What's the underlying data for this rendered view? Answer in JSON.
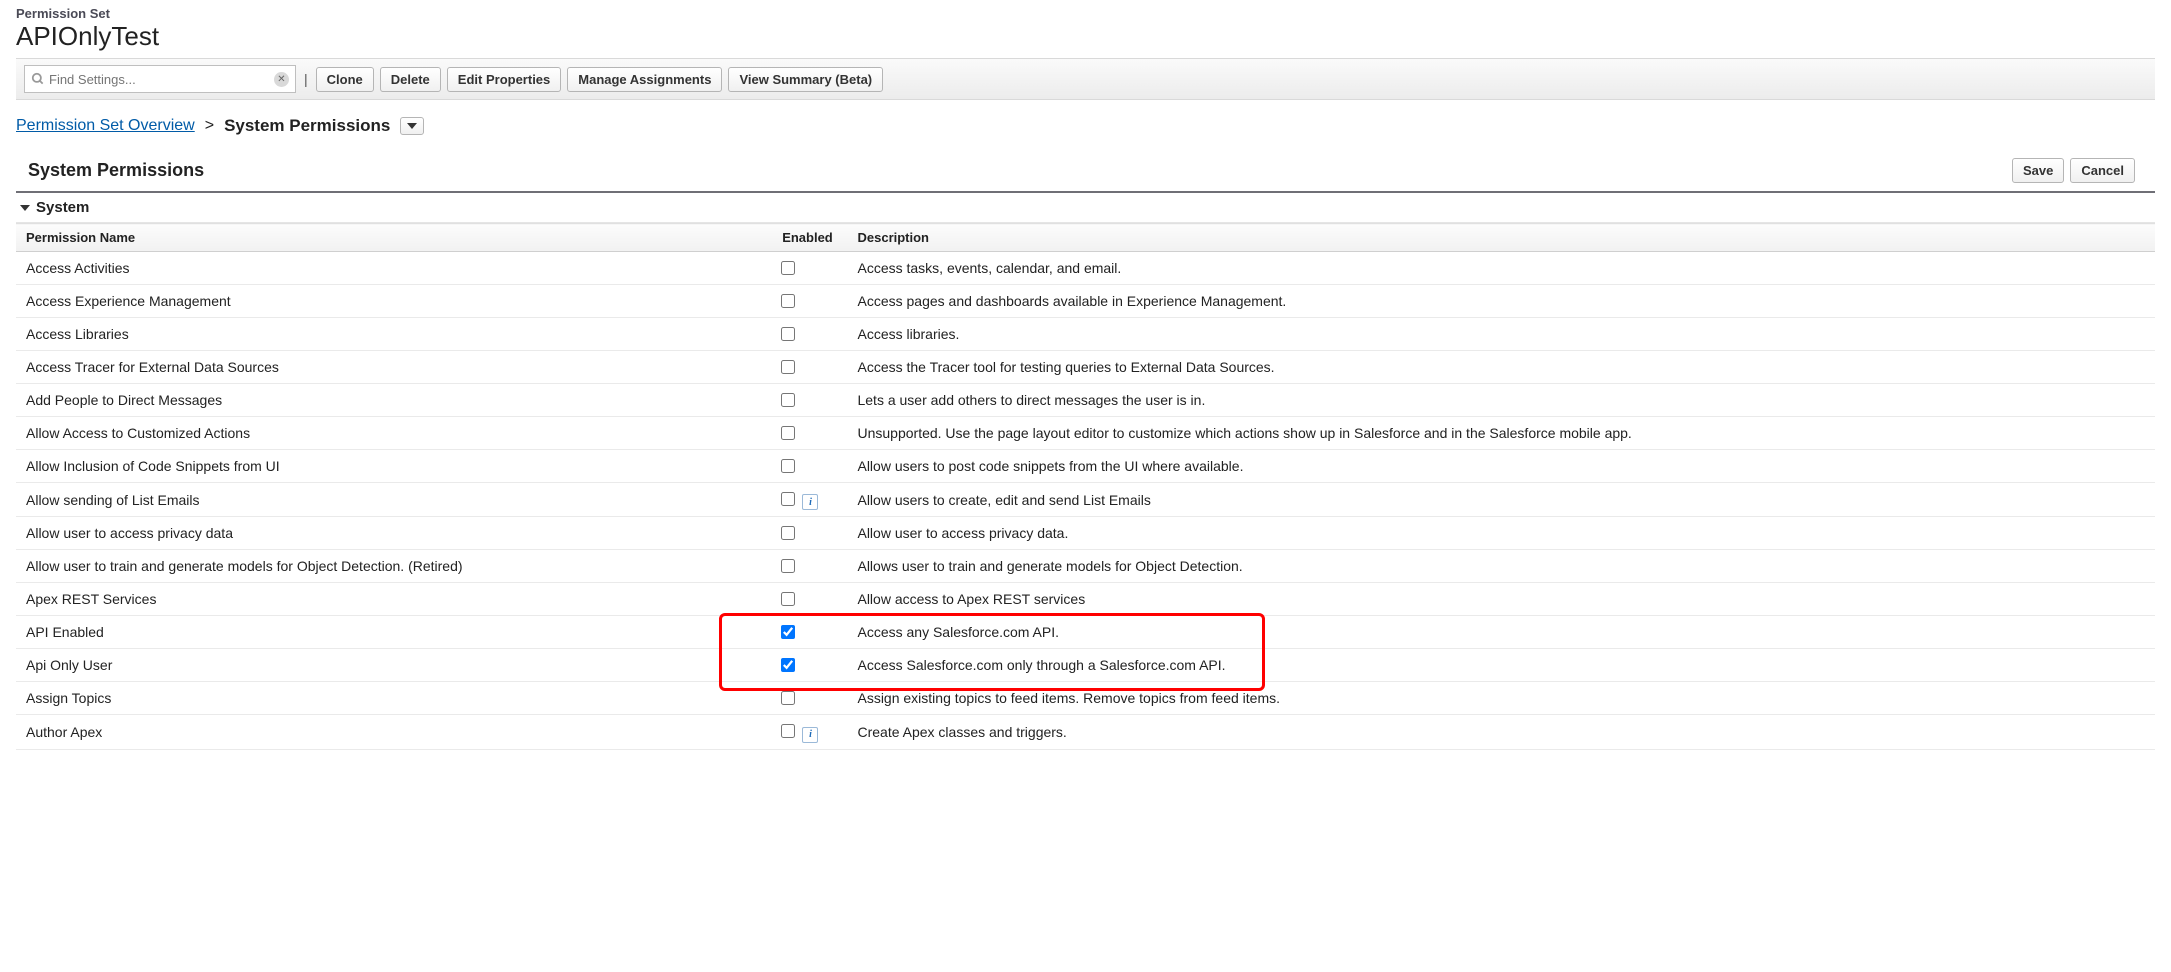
{
  "header": {
    "object_label": "Permission Set",
    "title": "APIOnlyTest",
    "search_placeholder": "Find Settings...",
    "buttons": {
      "clone": "Clone",
      "delete": "Delete",
      "edit": "Edit Properties",
      "manage": "Manage Assignments",
      "summary": "View Summary (Beta)"
    }
  },
  "breadcrumb": {
    "overview": "Permission Set Overview",
    "current": "System Permissions"
  },
  "section": {
    "title": "System Permissions",
    "save": "Save",
    "cancel": "Cancel",
    "group": "System"
  },
  "columns": {
    "name": "Permission Name",
    "enabled": "Enabled",
    "description": "Description"
  },
  "permissions": [
    {
      "name": "Access Activities",
      "enabled": false,
      "info": false,
      "desc": "Access tasks, events, calendar, and email."
    },
    {
      "name": "Access Experience Management",
      "enabled": false,
      "info": false,
      "desc": "Access pages and dashboards available in Experience Management."
    },
    {
      "name": "Access Libraries",
      "enabled": false,
      "info": false,
      "desc": "Access libraries."
    },
    {
      "name": "Access Tracer for External Data Sources",
      "enabled": false,
      "info": false,
      "desc": "Access the Tracer tool for testing queries to External Data Sources."
    },
    {
      "name": "Add People to Direct Messages",
      "enabled": false,
      "info": false,
      "desc": "Lets a user add others to direct messages the user is in."
    },
    {
      "name": "Allow Access to Customized Actions",
      "enabled": false,
      "info": false,
      "desc": "Unsupported. Use the page layout editor to customize which actions show up in Salesforce and in the Salesforce mobile app."
    },
    {
      "name": "Allow Inclusion of Code Snippets from UI",
      "enabled": false,
      "info": false,
      "desc": "Allow users to post code snippets from the UI where available."
    },
    {
      "name": "Allow sending of List Emails",
      "enabled": false,
      "info": true,
      "desc": "Allow users to create, edit and send List Emails"
    },
    {
      "name": "Allow user to access privacy data",
      "enabled": false,
      "info": false,
      "desc": "Allow user to access privacy data."
    },
    {
      "name": "Allow user to train and generate models for Object Detection. (Retired)",
      "enabled": false,
      "info": false,
      "desc": "Allows user to train and generate models for Object Detection."
    },
    {
      "name": "Apex REST Services",
      "enabled": false,
      "info": false,
      "desc": "Allow access to Apex REST services"
    },
    {
      "name": "API Enabled",
      "enabled": true,
      "info": false,
      "desc": "Access any Salesforce.com API."
    },
    {
      "name": "Api Only User",
      "enabled": true,
      "info": false,
      "desc": "Access Salesforce.com only through a Salesforce.com API."
    },
    {
      "name": "Assign Topics",
      "enabled": false,
      "info": false,
      "desc": "Assign existing topics to feed items. Remove topics from feed items."
    },
    {
      "name": "Author Apex",
      "enabled": false,
      "info": true,
      "desc": "Create Apex classes and triggers."
    }
  ],
  "highlight_rows": [
    11,
    12
  ]
}
